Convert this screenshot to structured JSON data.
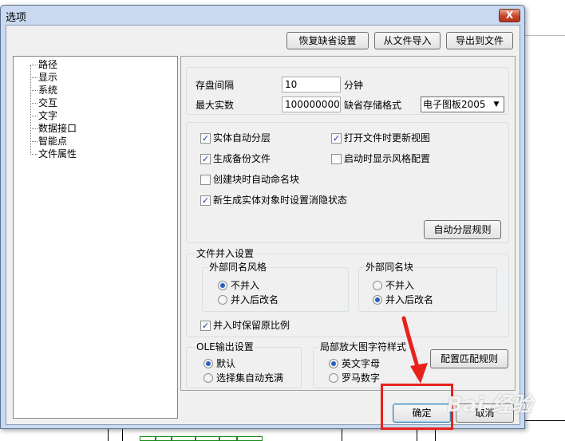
{
  "window": {
    "title": "选项",
    "close_label": "X"
  },
  "toolbar": {
    "restore_defaults": "恢复缺省设置",
    "import_from_file": "从文件导入",
    "export_to_file": "导出到文件"
  },
  "tree": {
    "items": [
      {
        "label": "路径"
      },
      {
        "label": "显示"
      },
      {
        "label": "系统"
      },
      {
        "label": "交互"
      },
      {
        "label": "文字"
      },
      {
        "label": "数据接口"
      },
      {
        "label": "智能点"
      },
      {
        "label": "文件属性"
      }
    ]
  },
  "storage": {
    "save_interval_label": "存盘间隔",
    "save_interval_value": "10",
    "save_interval_unit": "分钟",
    "max_entities_label": "最大实数",
    "max_entities_value": "100000000",
    "default_format_label": "缺省存储格式",
    "default_format_value": "电子图板2005"
  },
  "options": {
    "auto_layer": "实体自动分层",
    "update_view_on_open": "打开文件时更新视图",
    "create_backup": "生成备份文件",
    "show_style_config_on_start": "启动时显示风格配置",
    "auto_name_block": "创建块时自动命名块",
    "set_hidden_state": "新生成实体对象时设置消隐状态",
    "auto_layer_rules_button": "自动分层规则"
  },
  "merge": {
    "group_title": "文件并入设置",
    "style_group_title": "外部同名风格",
    "style_no_merge": "不并入",
    "style_rename_merge": "并入后改名",
    "block_group_title": "外部同名块",
    "block_no_merge": "不并入",
    "block_rename_merge": "并入后改名",
    "keep_scale": "并入时保留原比例"
  },
  "ole": {
    "group_title": "OLE输出设置",
    "default": "默认",
    "auto_fill": "选择集自动充满"
  },
  "zoom_text": {
    "group_title": "局部放大图字符样式",
    "letters": "英文字母",
    "roman": "罗马数字"
  },
  "match_rules_button": "配置匹配规则",
  "footer": {
    "ok": "确定",
    "cancel": "取消"
  },
  "watermark_text": "Bai 经验",
  "colors": {
    "annotation_red": "#e8221b",
    "titlebar": "#c9daf0"
  }
}
